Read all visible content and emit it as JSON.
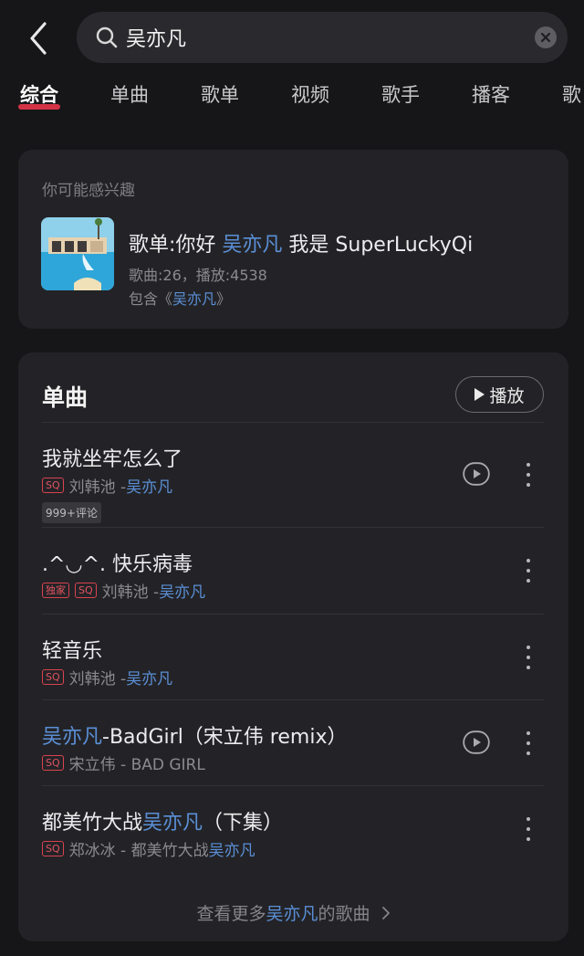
{
  "search": {
    "query": "吴亦凡"
  },
  "tabs": [
    "综合",
    "单曲",
    "歌单",
    "视频",
    "歌手",
    "播客",
    "歌"
  ],
  "interest": {
    "label": "你可能感兴趣",
    "title_prefix": "歌单:你好 ",
    "title_highlight": "吴亦凡",
    "title_suffix": " 我是 SuperLuckyQi",
    "meta": "歌曲:26，播放:4538",
    "contains_prefix": "包含《",
    "contains_highlight": "吴亦凡",
    "contains_suffix": "》"
  },
  "songs_section": {
    "title": "单曲",
    "play_label": "播放",
    "see_more_prefix": "查看更多",
    "see_more_highlight": "吴亦凡",
    "see_more_suffix": "的歌曲",
    "items": [
      {
        "name_pre": "我就坐牢怎么了",
        "name_hl": "",
        "name_post": "",
        "badges": [
          "SQ"
        ],
        "artist": "刘韩池 - ",
        "artist_hl": "吴亦凡",
        "artist_post": "",
        "comment": "999+评论",
        "has_video": true
      },
      {
        "name_pre": ".^◡^. 快乐病毒",
        "name_hl": "",
        "name_post": "",
        "badges": [
          "独家",
          "SQ"
        ],
        "artist": "刘韩池 - ",
        "artist_hl": "吴亦凡",
        "artist_post": "",
        "comment": "",
        "has_video": false
      },
      {
        "name_pre": "轻音乐",
        "name_hl": "",
        "name_post": "",
        "badges": [
          "SQ"
        ],
        "artist": "刘韩池 - ",
        "artist_hl": "吴亦凡",
        "artist_post": "",
        "comment": "",
        "has_video": false
      },
      {
        "name_pre": "",
        "name_hl": "吴亦凡",
        "name_post": "-BadGirl（宋立伟 remix）",
        "badges": [
          "SQ"
        ],
        "artist": "宋立伟 - BAD GIRL",
        "artist_hl": "",
        "artist_post": "",
        "comment": "",
        "has_video": true
      },
      {
        "name_pre": "都美竹大战",
        "name_hl": "吴亦凡",
        "name_post": "（下集）",
        "badges": [
          "SQ"
        ],
        "artist": "郑冰冰 - 都美竹大战",
        "artist_hl": "吴亦凡",
        "artist_post": "",
        "comment": "",
        "has_video": false
      }
    ]
  },
  "colors": {
    "accent_red": "#e8364a",
    "highlight_blue": "#5b8fd6",
    "card_bg": "#232327"
  }
}
